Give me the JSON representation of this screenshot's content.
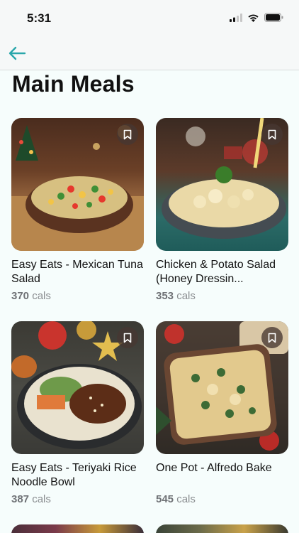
{
  "status": {
    "time": "5:31"
  },
  "nav": {
    "back_icon": "arrow-left-icon",
    "accent": "#2aa7ab"
  },
  "page": {
    "title": "Main Meals"
  },
  "meals": [
    {
      "title": "Easy Eats - Mexican Tuna Salad",
      "cals": "370",
      "cals_unit": "cals"
    },
    {
      "title": "Chicken & Potato Salad (Honey Dressin...",
      "cals": "353",
      "cals_unit": "cals"
    },
    {
      "title": "Easy Eats - Teriyaki Rice Noodle Bowl",
      "cals": "387",
      "cals_unit": "cals"
    },
    {
      "title": "One Pot - Alfredo Bake",
      "cals": "545",
      "cals_unit": "cals"
    }
  ]
}
